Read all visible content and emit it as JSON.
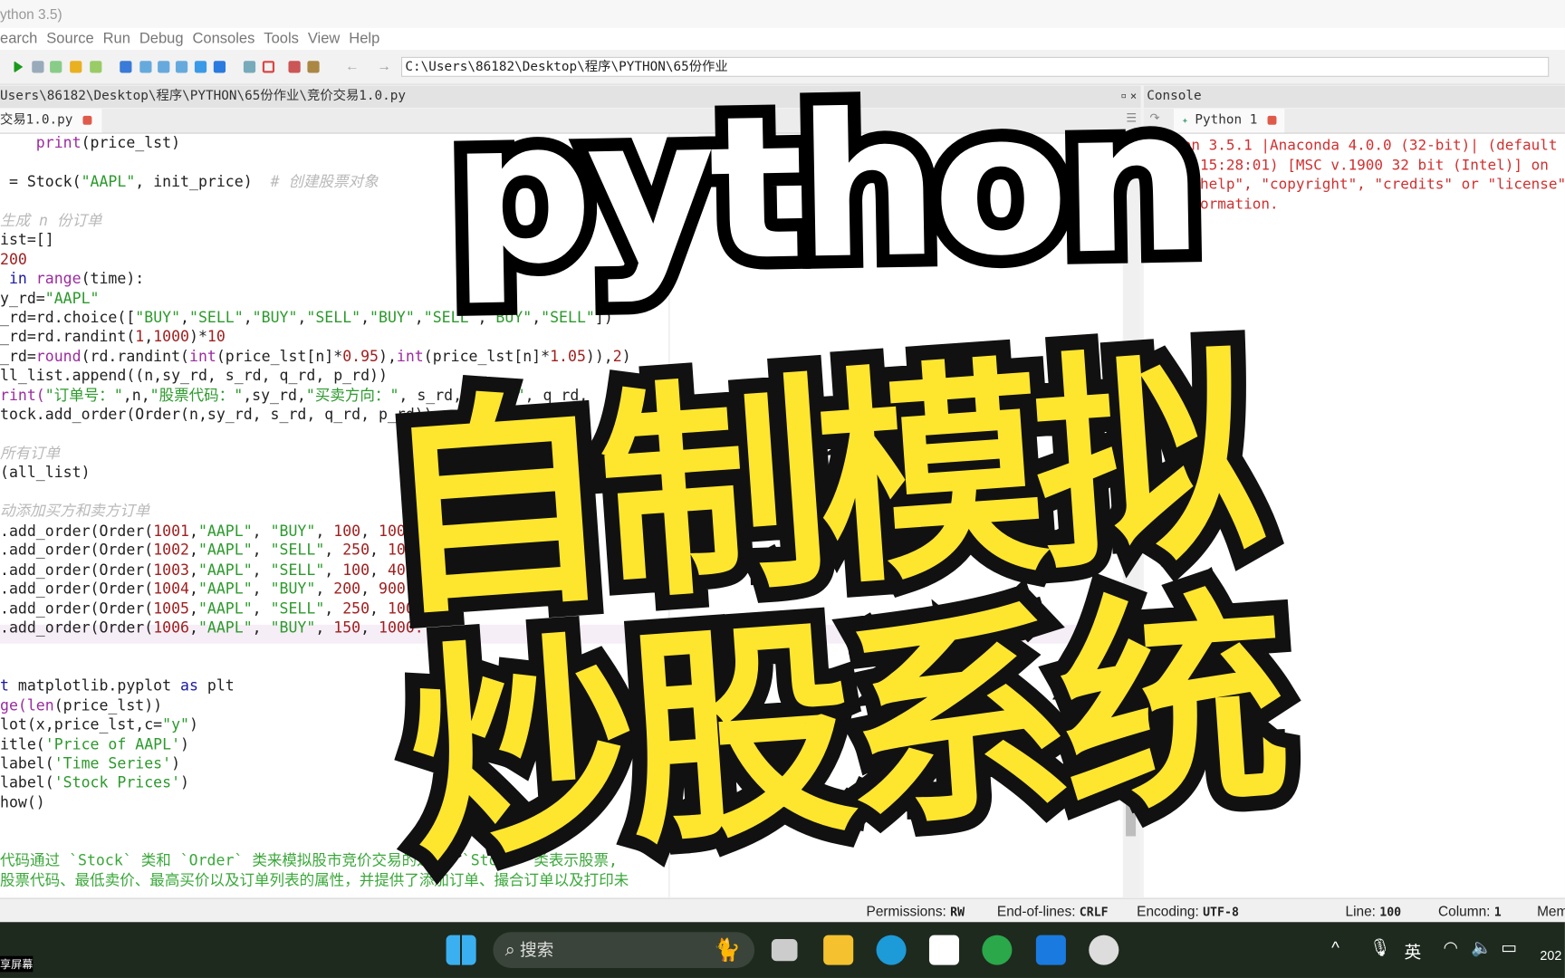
{
  "window": {
    "title": "ython 3.5)"
  },
  "menu": [
    "earch",
    "Source",
    "Run",
    "Debug",
    "Consoles",
    "Tools",
    "View",
    "Help"
  ],
  "toolbar": {
    "path": "C:\\Users\\86182\\Desktop\\程序\\PYTHON\\65份作业",
    "back_icon": "arrow-left",
    "forward_icon": "arrow-right"
  },
  "editor": {
    "path": "Users\\86182\\Desktop\\程序\\PYTHON\\65份作业\\竞价交易1.0.py",
    "tab": "交易1.0.py",
    "lines": [
      [
        [
          "    "
        ],
        [
          "print",
          "b"
        ],
        [
          "(price_lst)"
        ]
      ],
      [
        [
          ""
        ]
      ],
      [
        [
          " = Stock("
        ],
        [
          "\"AAPL\"",
          "s"
        ],
        [
          ", init_price)  "
        ],
        [
          "# 创建股票对象",
          "c"
        ]
      ],
      [
        [
          ""
        ]
      ],
      [
        [
          "生成 n 份订单",
          "c"
        ]
      ],
      [
        [
          "ist=[]"
        ]
      ],
      [
        [
          "200",
          "n"
        ]
      ],
      [
        [
          " "
        ],
        [
          "in",
          "k"
        ],
        [
          " "
        ],
        [
          "range",
          "b"
        ],
        [
          "(time):"
        ]
      ],
      [
        [
          "y_rd="
        ],
        [
          "\"AAPL\"",
          "s"
        ]
      ],
      [
        [
          "_rd=rd.choice(["
        ],
        [
          "\"BUY\"",
          "s"
        ],
        [
          ","
        ],
        [
          "\"SELL\"",
          "s"
        ],
        [
          ","
        ],
        [
          "\"BUY\"",
          "s"
        ],
        [
          ","
        ],
        [
          "\"SELL\"",
          "s"
        ],
        [
          ","
        ],
        [
          "\"BUY\"",
          "s"
        ],
        [
          ","
        ],
        [
          "\"SELL\"",
          "s"
        ],
        [
          ","
        ],
        [
          "\"BUY\"",
          "s"
        ],
        [
          ","
        ],
        [
          "\"SELL\"",
          "s"
        ],
        [
          "])"
        ]
      ],
      [
        [
          "_rd=rd.randint("
        ],
        [
          "1",
          "n"
        ],
        [
          ","
        ],
        [
          "1000",
          "n"
        ],
        [
          ")*"
        ],
        [
          "10",
          "n"
        ]
      ],
      [
        [
          "_rd="
        ],
        [
          "round",
          "b"
        ],
        [
          "(rd.randint("
        ],
        [
          "int",
          "b"
        ],
        [
          "(price_lst[n]*"
        ],
        [
          "0.95",
          "n"
        ],
        [
          "),"
        ],
        [
          "int",
          "b"
        ],
        [
          "(price_lst[n]*"
        ],
        [
          "1.05",
          "n"
        ],
        [
          ")),"
        ],
        [
          "2",
          "n"
        ],
        [
          ")"
        ]
      ],
      [
        [
          "ll_list.append((n,sy_rd, s_rd, q_rd, p_rd))"
        ]
      ],
      [
        [
          "rint(",
          "b"
        ],
        [
          "\"订单号：\"",
          "s"
        ],
        [
          ",n,"
        ],
        [
          "\"股票代码：\"",
          "s"
        ],
        [
          ",sy_rd,"
        ],
        [
          "\"买卖方向：\"",
          "s"
        ],
        [
          ", s_rd,"
        ],
        [
          "\"数量：\"",
          "s"
        ],
        [
          ", q_rd,"
        ]
      ],
      [
        [
          "tock.add_order(Order(n,sy_rd, s_rd, q_rd, p_rd))"
        ]
      ],
      [
        [
          ""
        ]
      ],
      [
        [
          "所有订单",
          "c"
        ]
      ],
      [
        [
          "(all_list)"
        ]
      ],
      [
        [
          ""
        ]
      ],
      [
        [
          "动添加买方和卖方订单",
          "c"
        ]
      ],
      [
        [
          ".add_order(Order("
        ],
        [
          "1001",
          "n"
        ],
        [
          ","
        ],
        [
          "\"AAPL\"",
          "s"
        ],
        [
          ", "
        ],
        [
          "\"BUY\"",
          "s"
        ],
        [
          ", "
        ],
        [
          "100",
          "n"
        ],
        [
          ", "
        ],
        [
          "100",
          "n"
        ]
      ],
      [
        [
          ".add_order(Order("
        ],
        [
          "1002",
          "n"
        ],
        [
          ","
        ],
        [
          "\"AAPL\"",
          "s"
        ],
        [
          ", "
        ],
        [
          "\"SELL\"",
          "s"
        ],
        [
          ", "
        ],
        [
          "250",
          "n"
        ],
        [
          ", "
        ],
        [
          "10",
          "n"
        ]
      ],
      [
        [
          ".add_order(Order("
        ],
        [
          "1003",
          "n"
        ],
        [
          ","
        ],
        [
          "\"AAPL\"",
          "s"
        ],
        [
          ", "
        ],
        [
          "\"SELL\"",
          "s"
        ],
        [
          ", "
        ],
        [
          "100",
          "n"
        ],
        [
          ", "
        ],
        [
          "400",
          "n"
        ]
      ],
      [
        [
          ".add_order(Order("
        ],
        [
          "1004",
          "n"
        ],
        [
          ","
        ],
        [
          "\"AAPL\"",
          "s"
        ],
        [
          ", "
        ],
        [
          "\"BUY\"",
          "s"
        ],
        [
          ", "
        ],
        [
          "200",
          "n"
        ],
        [
          ", "
        ],
        [
          "900.",
          "n"
        ]
      ],
      [
        [
          ".add_order(Order("
        ],
        [
          "1005",
          "n"
        ],
        [
          ","
        ],
        [
          "\"AAPL\"",
          "s"
        ],
        [
          ", "
        ],
        [
          "\"SELL\"",
          "s"
        ],
        [
          ", "
        ],
        [
          "250",
          "n"
        ],
        [
          ", "
        ],
        [
          "1000",
          "n"
        ]
      ],
      [
        [
          ".add_order(Order("
        ],
        [
          "1006",
          "n"
        ],
        [
          ","
        ],
        [
          "\"AAPL\"",
          "s"
        ],
        [
          ", "
        ],
        [
          "\"BUY\"",
          "s"
        ],
        [
          ", "
        ],
        [
          "150",
          "n"
        ],
        [
          ", "
        ],
        [
          "1000.",
          "n"
        ]
      ],
      [
        [
          ""
        ]
      ],
      [
        [
          ""
        ]
      ],
      [
        [
          "t",
          "k"
        ],
        [
          " matplotlib.pyplot "
        ],
        [
          "as",
          "k"
        ],
        [
          " plt"
        ]
      ],
      [
        [
          "ge(",
          "b"
        ],
        [
          "len",
          "b"
        ],
        [
          "(price_lst))"
        ]
      ],
      [
        [
          "lot(x,price_lst,c="
        ],
        [
          "\"y\"",
          "s"
        ],
        [
          ")"
        ]
      ],
      [
        [
          "itle("
        ],
        [
          "'Price of AAPL'",
          "s"
        ],
        [
          ")"
        ]
      ],
      [
        [
          "label("
        ],
        [
          "'Time Series'",
          "s"
        ],
        [
          ")"
        ]
      ],
      [
        [
          "label("
        ],
        [
          "'Stock Prices'",
          "s"
        ],
        [
          ")"
        ]
      ],
      [
        [
          "how()"
        ]
      ],
      [
        [
          ""
        ]
      ],
      [
        [
          ""
        ]
      ],
      [
        [
          "代码通过 `Stock` 类和 `Order` 类来模拟股市竞价交易的过程。`Stock` 类表示股票,",
          "d"
        ]
      ],
      [
        [
          "股票代码、最低卖价、最高买价以及订单列表的属性，并提供了添加订单、撮合订单以及打印未",
          "d"
        ]
      ]
    ]
  },
  "console": {
    "title": "Console",
    "tab": "Python 1",
    "text": "Python 3.5.1 |Anaconda 4.0.0 (32-bit)| (default\n2016, 15:28:01) [MSC v.1900 32 bit (Intel)] on\nType \"help\", \"copyright\", \"credits\" or \"license\"\nre information.\n>>>"
  },
  "status": {
    "permissions_label": "Permissions:",
    "permissions": "RW",
    "eol_label": "End-of-lines:",
    "eol": "CRLF",
    "encoding_label": "Encoding:",
    "encoding": "UTF-8",
    "line_label": "Line:",
    "line": "100",
    "column_label": "Column:",
    "column": "1",
    "memory_label": "Mem"
  },
  "taskbar": {
    "search_placeholder": "搜索",
    "ime": "英",
    "clock": "202",
    "share_label": "享屏幕"
  },
  "overlay": {
    "title": "python",
    "line1": "自制模拟",
    "line2": "炒股系统"
  },
  "colors": {
    "overlay_yellow": "#ffe62e",
    "console_text": "#d03030",
    "string": "#2c9a2c",
    "number": "#a02020"
  }
}
